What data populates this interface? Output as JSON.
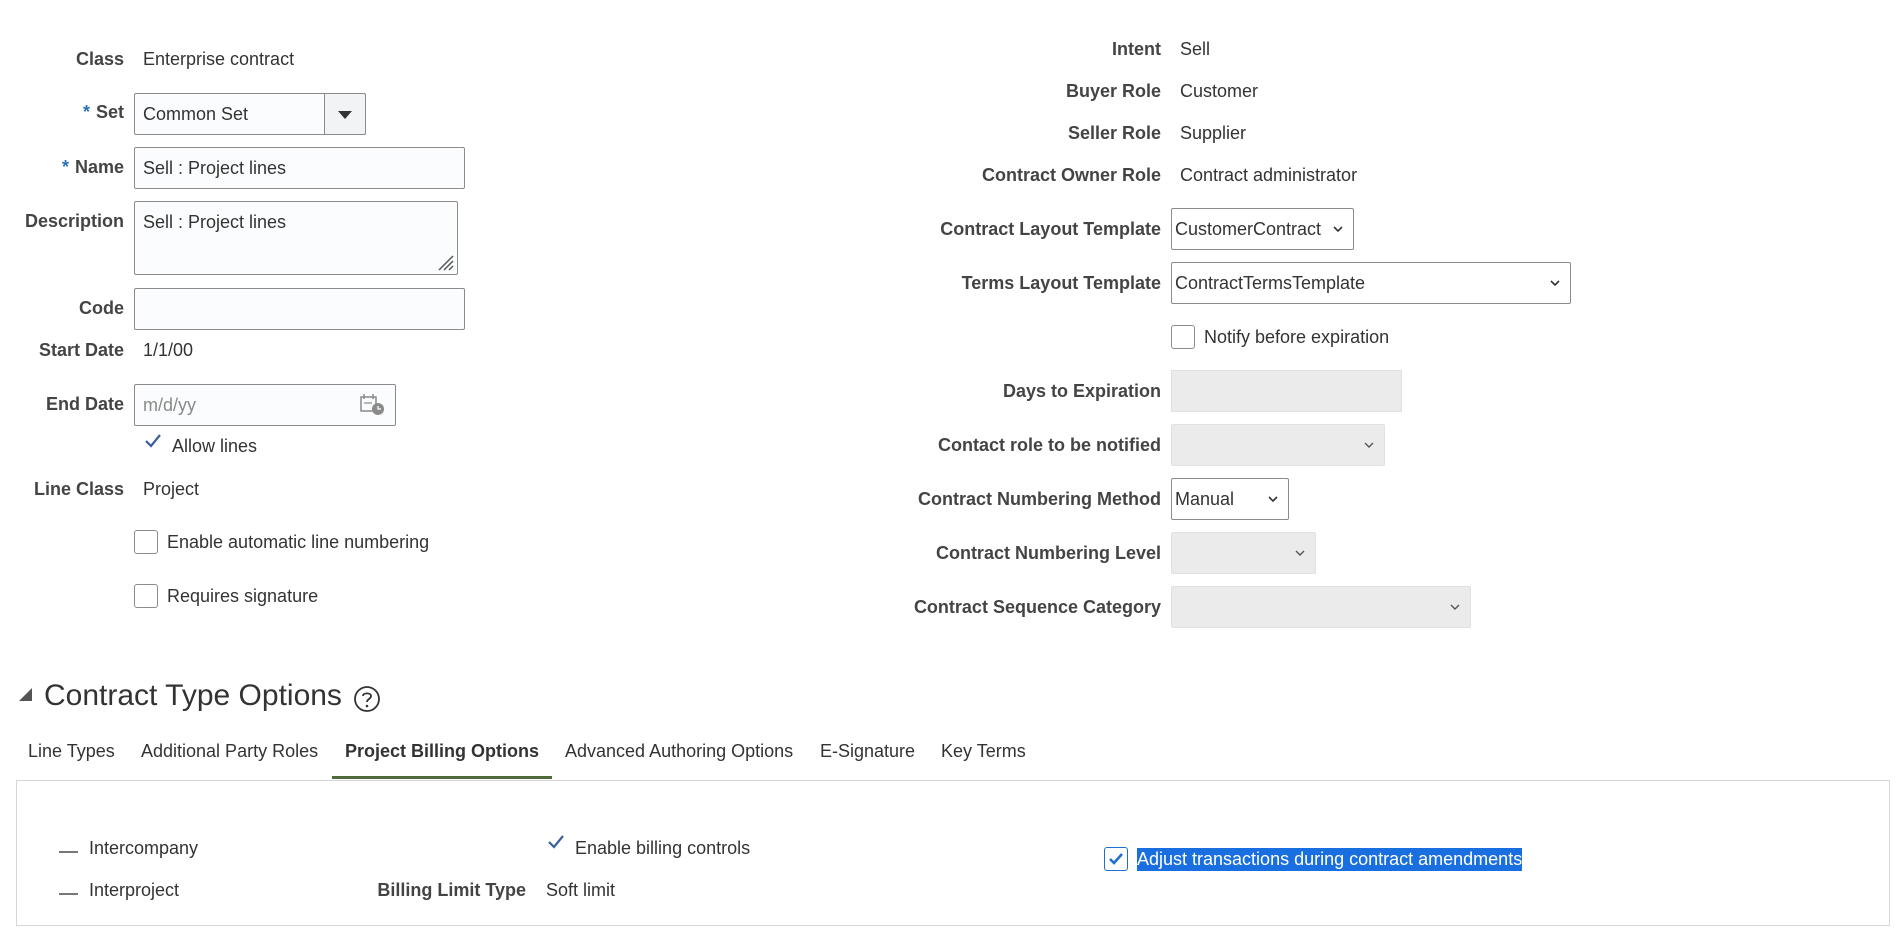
{
  "form": {
    "class_label": "Class",
    "class_value": "Enterprise contract",
    "set_required": "*",
    "set_label": "Set",
    "set_value": "Common Set",
    "name_required": "*",
    "name_label": "Name",
    "name_value": "Sell : Project lines",
    "description_label": "Description",
    "description_value": "Sell : Project lines",
    "code_label": "Code",
    "code_value": "",
    "start_date_label": "Start Date",
    "start_date_value": "1/1/00",
    "end_date_label": "End Date",
    "end_date_placeholder": "m/d/yy",
    "allow_lines_label": "Allow lines",
    "allow_lines_checked": true,
    "line_class_label": "Line Class",
    "line_class_value": "Project",
    "auto_line_numbering_label": "Enable automatic line numbering",
    "auto_line_numbering_checked": false,
    "requires_signature_label": "Requires signature",
    "requires_signature_checked": false
  },
  "right_form": {
    "intent_label": "Intent",
    "intent_value": "Sell",
    "buyer_role_label": "Buyer Role",
    "buyer_role_value": "Customer",
    "seller_role_label": "Seller Role",
    "seller_role_value": "Supplier",
    "owner_role_label": "Contract Owner Role",
    "owner_role_value": "Contract administrator",
    "layout_template_label": "Contract Layout Template",
    "layout_template_value": "CustomerContract",
    "terms_template_label": "Terms Layout Template",
    "terms_template_value": "ContractTermsTemplate",
    "notify_label": "Notify before expiration",
    "notify_checked": false,
    "days_label": "Days to Expiration",
    "days_value": "",
    "contact_role_label": "Contact role to be notified",
    "contact_role_value": "",
    "numbering_method_label": "Contract Numbering Method",
    "numbering_method_value": "Manual",
    "numbering_level_label": "Contract Numbering Level",
    "numbering_level_value": "",
    "sequence_category_label": "Contract Sequence Category",
    "sequence_category_value": ""
  },
  "options": {
    "title": "Contract Type Options",
    "tabs": [
      {
        "label": "Line Types",
        "active": false
      },
      {
        "label": "Additional Party Roles",
        "active": false
      },
      {
        "label": "Project Billing Options",
        "active": true
      },
      {
        "label": "Advanced Authoring Options",
        "active": false
      },
      {
        "label": "E-Signature",
        "active": false
      },
      {
        "label": "Key Terms",
        "active": false
      }
    ],
    "intercompany_label": "Intercompany",
    "interproject_label": "Interproject",
    "billing_controls_label": "Enable billing controls",
    "billing_limit_label": "Billing Limit Type",
    "billing_limit_value": "Soft limit",
    "adjust_label": "Adjust transactions during contract amendments",
    "adjust_checked": true
  },
  "colors": {
    "accent": "#1f6fd1",
    "tab_underline": "#4f6b3c",
    "selection_bg": "#1a6fe0",
    "label_text": "#444444",
    "disabled_bg": "#ebebeb"
  }
}
